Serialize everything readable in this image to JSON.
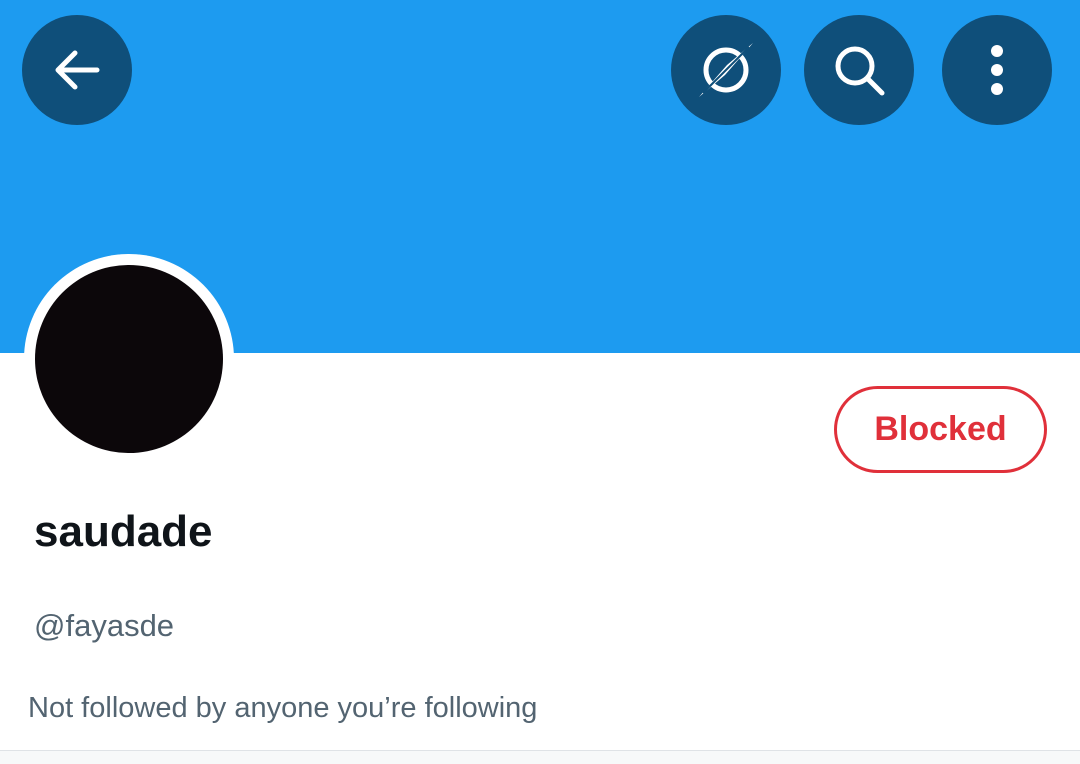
{
  "header": {
    "banner_color": "#1d9bf0",
    "buttons": [
      {
        "name": "back",
        "icon": "arrow-left-icon"
      },
      {
        "name": "explore",
        "icon": "compass-icon"
      },
      {
        "name": "search",
        "icon": "search-icon"
      },
      {
        "name": "more",
        "icon": "more-vertical-icon"
      }
    ]
  },
  "profile": {
    "avatar_color": "#0c070a",
    "display_name": "saudade",
    "handle": "@fayasde",
    "followers_note": "Not followed by anyone you’re following",
    "block_status_label": "Blocked",
    "block_color": "#e0303a"
  }
}
